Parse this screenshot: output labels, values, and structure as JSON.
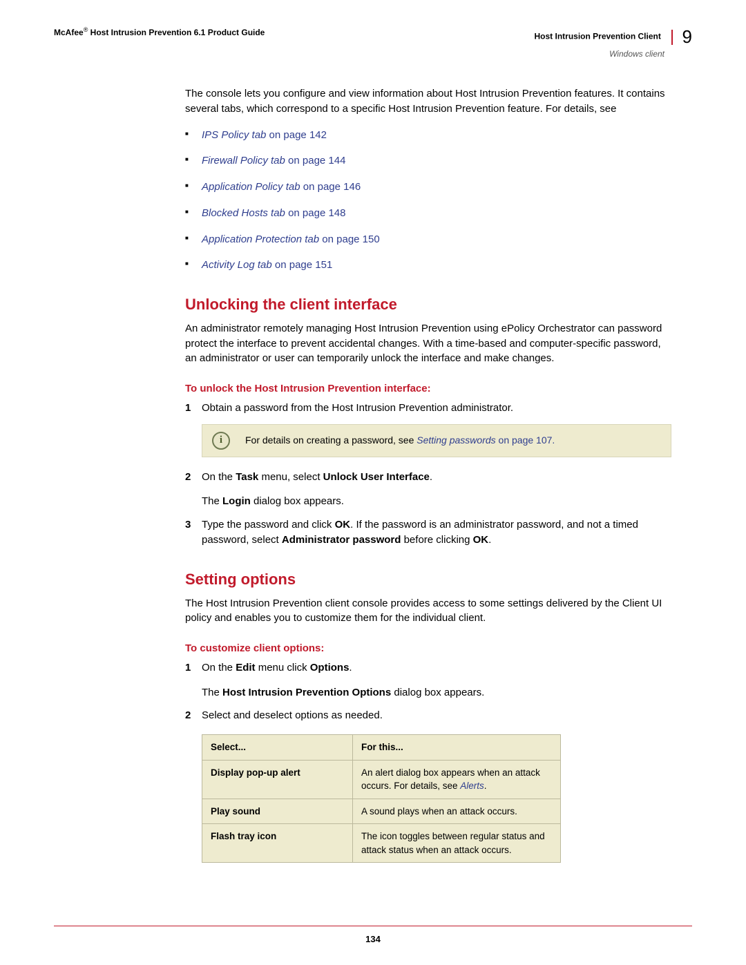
{
  "header": {
    "brand": "McAfee",
    "reg": "®",
    "title_rest": " Host Intrusion Prevention 6.1 Product Guide",
    "section_title": "Host Intrusion Prevention Client",
    "chapter_num": "9",
    "subsection": "Windows client"
  },
  "intro": "The console lets you configure and view information about Host Intrusion Prevention features. It contains several tabs, which correspond to a specific Host Intrusion Prevention feature. For details, see",
  "refs": [
    {
      "link": "IPS Policy tab",
      "suffix": " on page 142"
    },
    {
      "link": "Firewall Policy tab",
      "suffix": " on page 144"
    },
    {
      "link": "Application Policy tab",
      "suffix": " on page 146"
    },
    {
      "link": "Blocked Hosts tab",
      "suffix": " on page 148"
    },
    {
      "link": "Application Protection tab",
      "suffix": " on page 150"
    },
    {
      "link": "Activity Log tab",
      "suffix": " on page 151"
    }
  ],
  "unlock": {
    "heading": "Unlocking the client interface",
    "para": "An administrator remotely managing Host Intrusion Prevention using ePolicy Orchestrator can password protect the interface to prevent accidental changes. With a time-based and computer-specific password, an administrator or user can temporarily unlock the interface and make changes.",
    "proc_title": "To unlock the Host Intrusion Prevention interface:",
    "step1": "Obtain a password from the Host Intrusion Prevention administrator.",
    "note_prefix": "For details on creating a password, see ",
    "note_link": "Setting passwords",
    "note_suffix": " on page 107.",
    "step2_a": "On the ",
    "step2_b": "Task",
    "step2_c": " menu, select ",
    "step2_d": "Unlock User Interface",
    "step2_e": ".",
    "step2_p2_a": "The ",
    "step2_p2_b": "Login",
    "step2_p2_c": " dialog box appears.",
    "step3_a": "Type the password and click ",
    "step3_b": "OK",
    "step3_c": ". If the password is an administrator password, and not a timed password, select ",
    "step3_d": "Administrator password",
    "step3_e": " before clicking ",
    "step3_f": "OK",
    "step3_g": "."
  },
  "setopt": {
    "heading": "Setting options",
    "para": "The Host Intrusion Prevention client console provides access to some settings delivered by the Client UI policy and enables you to customize them for the individual client.",
    "proc_title": "To customize client options:",
    "step1_a": "On the ",
    "step1_b": "Edit",
    "step1_c": " menu click ",
    "step1_d": "Options",
    "step1_e": ".",
    "step1_p2_a": "The ",
    "step1_p2_b": "Host Intrusion Prevention Options",
    "step1_p2_c": " dialog box appears.",
    "step2": "Select and deselect options as needed.",
    "table": {
      "h1": "Select...",
      "h2": "For this...",
      "rows": [
        {
          "c1": "Display pop-up alert",
          "c2_a": "An alert dialog box appears when an attack occurs. For details, see ",
          "c2_link": "Alerts",
          "c2_b": "."
        },
        {
          "c1": "Play sound",
          "c2_a": "A sound plays when an attack occurs.",
          "c2_link": "",
          "c2_b": ""
        },
        {
          "c1": "Flash tray icon",
          "c2_a": "The icon toggles between regular status and attack status when an attack occurs.",
          "c2_link": "",
          "c2_b": ""
        }
      ]
    }
  },
  "page_number": "134"
}
